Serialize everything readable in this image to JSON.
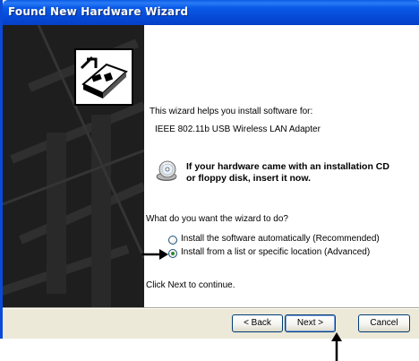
{
  "window": {
    "title": "Found New Hardware Wizard"
  },
  "content": {
    "intro": "This wizard helps you install software for:",
    "device_name": "IEEE 802.11b USB Wireless LAN Adapter",
    "cd_prompt_line1": "If your hardware came with an installation CD",
    "cd_prompt_line2": "or floppy disk, insert it now.",
    "question": "What do you want the wizard to do?",
    "options": [
      {
        "label": "Install the software automatically (Recommended)",
        "selected": false
      },
      {
        "label": "Install from a list or specific location (Advanced)",
        "selected": true
      }
    ],
    "continue_hint": "Click Next to continue."
  },
  "footer": {
    "back_label": "< Back",
    "next_label": "Next >",
    "cancel_label": "Cancel"
  },
  "colors": {
    "titlebar": "#0a5ae8",
    "panel": "#1e1e1e",
    "dialog_bg": "#ece9d8",
    "button_border": "#003c74"
  }
}
